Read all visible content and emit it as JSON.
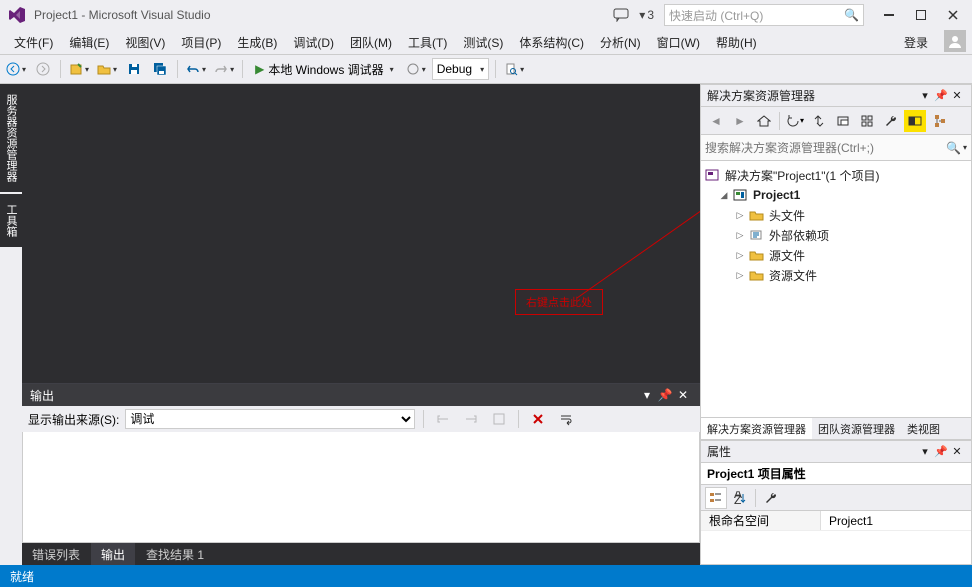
{
  "title": "Project1 - Microsoft Visual Studio",
  "notification_count": "3",
  "quick_launch_placeholder": "快速启动 (Ctrl+Q)",
  "menu": [
    "文件(F)",
    "编辑(E)",
    "视图(V)",
    "项目(P)",
    "生成(B)",
    "调试(D)",
    "团队(M)",
    "工具(T)",
    "测试(S)",
    "体系结构(C)",
    "分析(N)",
    "窗口(W)",
    "帮助(H)"
  ],
  "signin": "登录",
  "toolbar": {
    "debug_target": "本地 Windows 调试器",
    "config": "Debug"
  },
  "left_tabs": [
    "服务器资源管理器",
    "工具箱"
  ],
  "output": {
    "title": "输出",
    "source_label": "显示输出来源(S):",
    "source_value": "调试"
  },
  "bottom_tabs": [
    "错误列表",
    "输出",
    "查找结果 1"
  ],
  "bottom_active": 1,
  "explorer": {
    "title": "解决方案资源管理器",
    "search_placeholder": "搜索解决方案资源管理器(Ctrl+;)",
    "solution": "解决方案\"Project1\"(1 个项目)",
    "project": "Project1",
    "folders": [
      "头文件",
      "外部依赖项",
      "源文件",
      "资源文件"
    ],
    "tabs": [
      "解决方案资源管理器",
      "团队资源管理器",
      "类视图"
    ]
  },
  "props": {
    "title": "属性",
    "object": "Project1 项目属性",
    "rows": [
      {
        "name": "根命名空间",
        "value": "Project1"
      }
    ]
  },
  "annotation": "右键点击此处",
  "status": "就绪"
}
